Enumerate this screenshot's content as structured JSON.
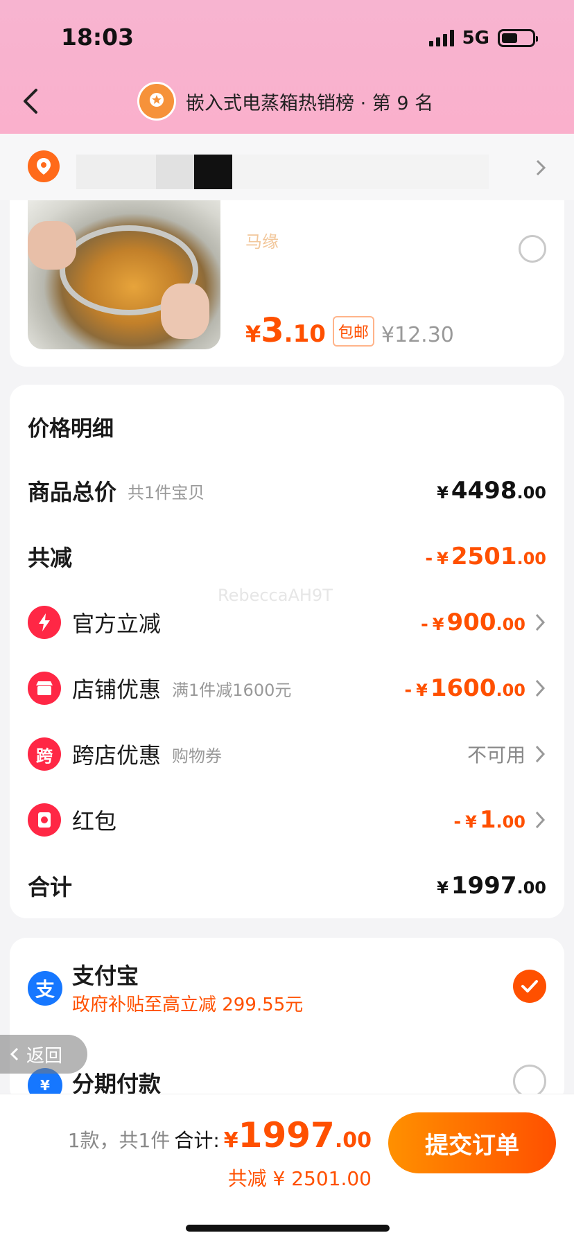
{
  "status_bar": {
    "time": "18:03",
    "network": "5G"
  },
  "header": {
    "title": "嵌入式电蒸箱热销榜 · 第 9 名"
  },
  "product": {
    "shop_name": "马缘",
    "price_currency": "¥",
    "price_int": "3",
    "price_dec": ".10",
    "tag": "包邮",
    "original_price": "¥12.30"
  },
  "price_detail": {
    "title": "价格明细",
    "watermark": "RebeccaAH9T",
    "rows": [
      {
        "label": "商品总价",
        "sub": "共1件宝贝",
        "minus": "",
        "currency": "¥",
        "int": "4498",
        "dec": ".00"
      },
      {
        "label": "共减",
        "sub": "",
        "minus": "-",
        "currency": "¥",
        "int": "2501",
        "dec": ".00"
      },
      {
        "label": "官方立减",
        "sub": "",
        "minus": "-",
        "currency": "¥",
        "int": "900",
        "dec": ".00",
        "icon": "lightning-icon"
      },
      {
        "label": "店铺优惠",
        "sub": "满1件减1600元",
        "minus": "-",
        "currency": "¥",
        "int": "1600",
        "dec": ".00",
        "icon": "shop-icon"
      },
      {
        "label": "跨店优惠",
        "sub": "购物券",
        "text_value": "不可用",
        "icon_text": "跨",
        "icon": "cross-store-icon"
      },
      {
        "label": "红包",
        "sub": "",
        "minus": "-",
        "currency": "¥",
        "int": "1",
        "dec": ".00",
        "icon": "red-packet-icon"
      },
      {
        "label": "合计",
        "sub": "",
        "minus": "",
        "currency": "¥",
        "int": "1997",
        "dec": ".00"
      }
    ]
  },
  "payment": {
    "alipay": {
      "name": "支付宝",
      "sub": "政府补贴至高立减 299.55元",
      "icon_text": "支",
      "selected": true
    },
    "installment": {
      "name": "分期付款",
      "icon_text": "¥",
      "selected": false
    }
  },
  "back_pill": {
    "label": "返回"
  },
  "bottom": {
    "count": "1款，共1件",
    "total_label": "合计:",
    "currency": "¥",
    "total_int": "1997",
    "total_dec": ".00",
    "discount": "共减 ¥ 2501.00",
    "submit_label": "提交订单"
  },
  "colors": {
    "accent": "#ff5000",
    "header_bg": "#f7b4d0",
    "alipay_blue": "#1677ff"
  }
}
